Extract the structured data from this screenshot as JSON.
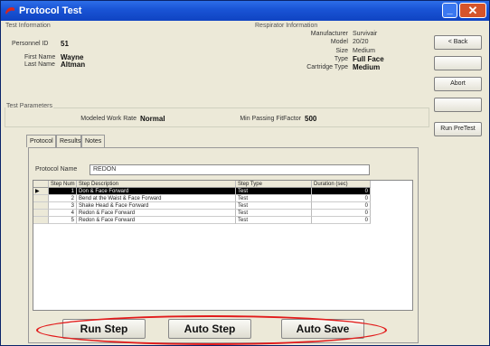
{
  "window": {
    "title": "Protocol Test",
    "minimize_icon": "minimize-icon",
    "close_icon": "close-icon",
    "accent": "#1a55d6"
  },
  "test_info": {
    "group_label": "Test Information",
    "personnel_id_label": "Personnel ID",
    "personnel_id": "51",
    "first_name_label": "First Name",
    "first_name": "Wayne",
    "last_name_label": "Last Name",
    "last_name": "Altman"
  },
  "respirator": {
    "group_label": "Respirator Information",
    "manufacturer_label": "Manufacturer",
    "manufacturer": "Survivair",
    "model_label": "Model",
    "model": "20/20",
    "size_label": "Size",
    "size": "Medium",
    "type_label": "Type",
    "type": "Full Face",
    "cartridge_label": "Cartridge Type",
    "cartridge": "Medium"
  },
  "params": {
    "group_label": "Test Parameters",
    "work_rate_label": "Modeled Work Rate",
    "work_rate": "Normal",
    "fitfactor_label": "Min Passing FitFactor",
    "fitfactor": "500"
  },
  "side_buttons": {
    "back": "< Back",
    "abort": "Abort",
    "runpretest": "Run PreTest"
  },
  "tabs": [
    "Protocol",
    "Results",
    "Notes"
  ],
  "protocol": {
    "name_label": "Protocol Name",
    "name": "REDON"
  },
  "grid": {
    "columns": [
      "Step Num",
      "Step Description",
      "Step Type",
      "Duration (sec)"
    ],
    "rows": [
      {
        "num": "1",
        "desc": "Don & Face Forward",
        "type": "Test",
        "duration": "0"
      },
      {
        "num": "2",
        "desc": "Bend at the Waist & Face Forward",
        "type": "Test",
        "duration": "0"
      },
      {
        "num": "3",
        "desc": "Shake Head & Face Forward",
        "type": "Test",
        "duration": "0"
      },
      {
        "num": "4",
        "desc": "Redon & Face Forward",
        "type": "Test",
        "duration": "0"
      },
      {
        "num": "5",
        "desc": "Redon & Face Forward",
        "type": "Test",
        "duration": "0"
      }
    ],
    "row_pointer_icon": "row-pointer-icon"
  },
  "bottom_buttons": {
    "run_step": "Run Step",
    "auto_step": "Auto Step",
    "auto_save": "Auto Save"
  },
  "annotation_color": "#e21b1b"
}
